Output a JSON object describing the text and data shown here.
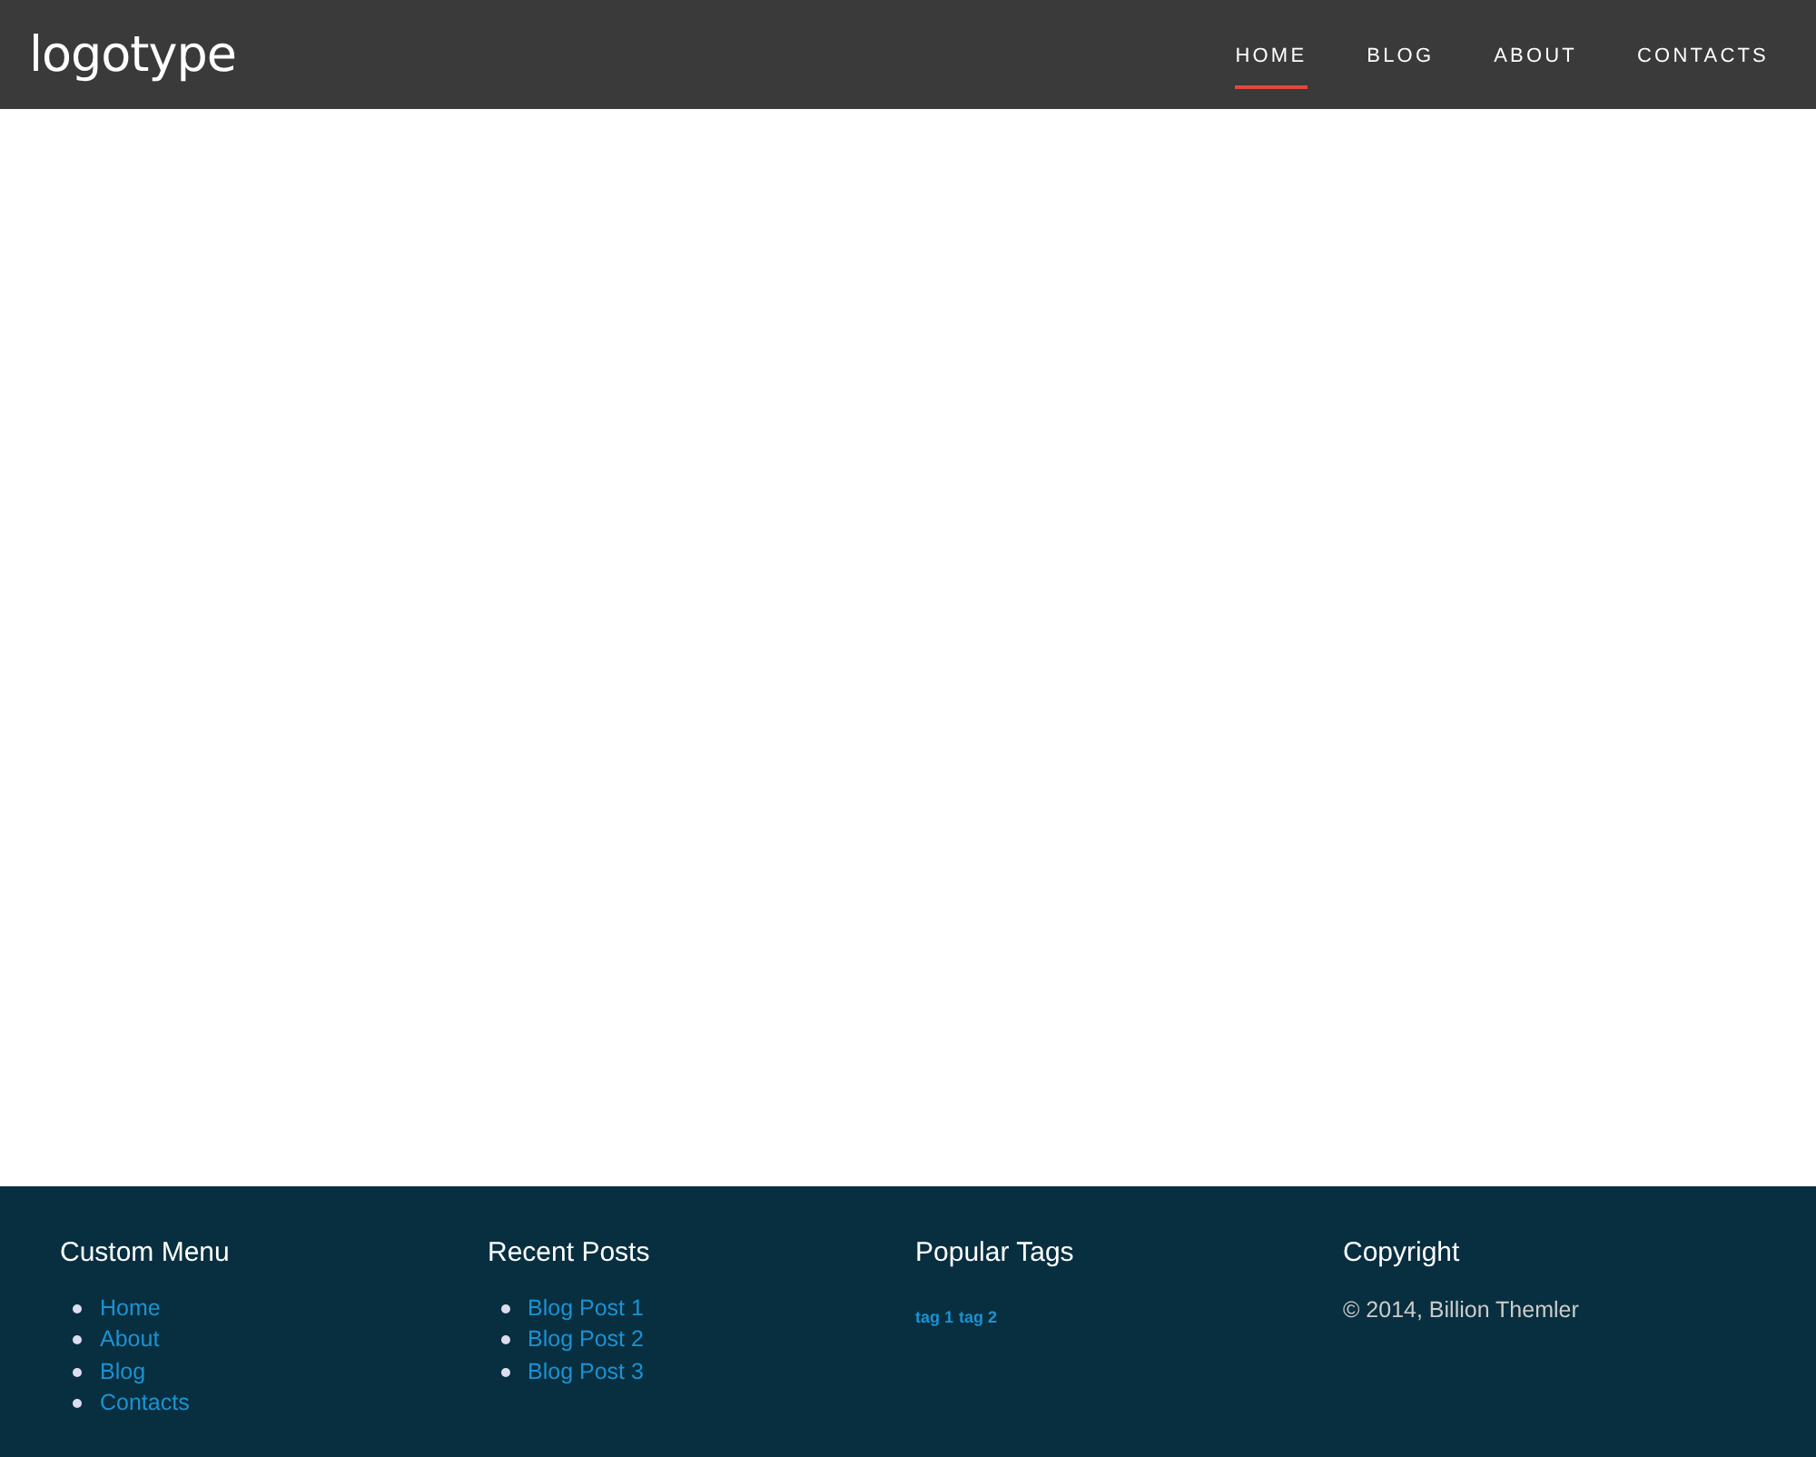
{
  "header": {
    "logo": "logotype",
    "nav": [
      {
        "label": "HOME",
        "selected": true
      },
      {
        "label": "BLOG",
        "selected": false
      },
      {
        "label": "ABOUT",
        "selected": false
      },
      {
        "label": "CONTACTS",
        "selected": false
      }
    ]
  },
  "footer": {
    "sections": [
      {
        "kind": "links",
        "title": "Custom Menu",
        "items": [
          "Home",
          "About",
          "Blog",
          "Contacts"
        ]
      },
      {
        "kind": "links",
        "title": "Recent Posts",
        "items": [
          "Blog Post 1",
          "Blog Post 2",
          "Blog Post 3"
        ]
      },
      {
        "kind": "tags",
        "title": "Popular Tags",
        "items": [
          "tag 1",
          "tag 2"
        ]
      },
      {
        "kind": "text",
        "title": "Copyright",
        "text": "© 2014, Billion Themler"
      }
    ]
  }
}
